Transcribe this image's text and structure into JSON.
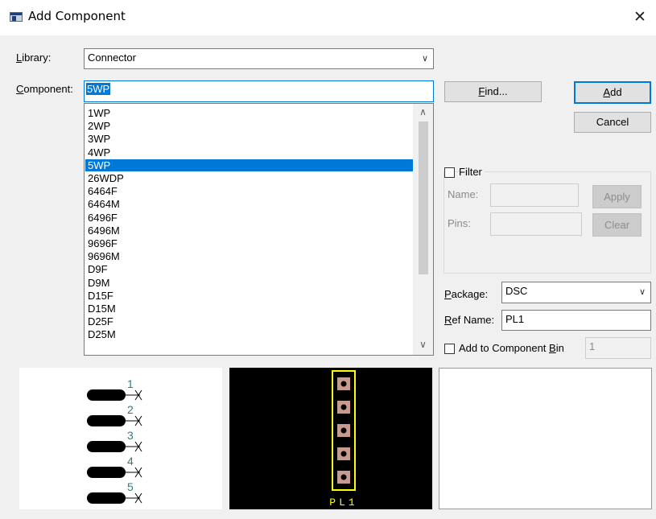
{
  "window": {
    "title": "Add Component",
    "close_glyph": "✕"
  },
  "library": {
    "label": "Library:",
    "value": "Connector"
  },
  "component": {
    "label": "Component:",
    "value": "5WP"
  },
  "buttons": {
    "find": "Find...",
    "add": "Add",
    "cancel": "Cancel",
    "apply": "Apply",
    "clear": "Clear"
  },
  "list": {
    "items": [
      "1WP",
      "2WP",
      "3WP",
      "4WP",
      "5WP",
      "26WDP",
      "6464F",
      "6464M",
      "6496F",
      "6496M",
      "9696F",
      "9696M",
      "D9F",
      "D9M",
      "D15F",
      "D15M",
      "D25F",
      "D25M"
    ],
    "selected": "5WP"
  },
  "filter": {
    "label": "Filter",
    "checked": false,
    "name_label": "Name:",
    "name_value": "",
    "pins_label": "Pins:",
    "pins_value": ""
  },
  "package": {
    "label": "Package:",
    "value": "DSC"
  },
  "ref_name": {
    "label": "Ref Name:",
    "value": "PL1"
  },
  "component_bin": {
    "label": "Add to Component Bin",
    "checked": false,
    "value": "1"
  },
  "schematic_preview": {
    "pin_numbers": [
      "1",
      "2",
      "3",
      "4",
      "5"
    ],
    "colors": {
      "pin_numbers": "#2e7d7d",
      "pins": "#000000"
    }
  },
  "pcb_preview": {
    "ref_label": "PL1",
    "colors": {
      "outline": "#ffff00",
      "pad": "#c89b8c",
      "background": "#000000"
    }
  },
  "colors": {
    "accent": "#0078d7",
    "dialog_bg": "#f0f0f0"
  }
}
